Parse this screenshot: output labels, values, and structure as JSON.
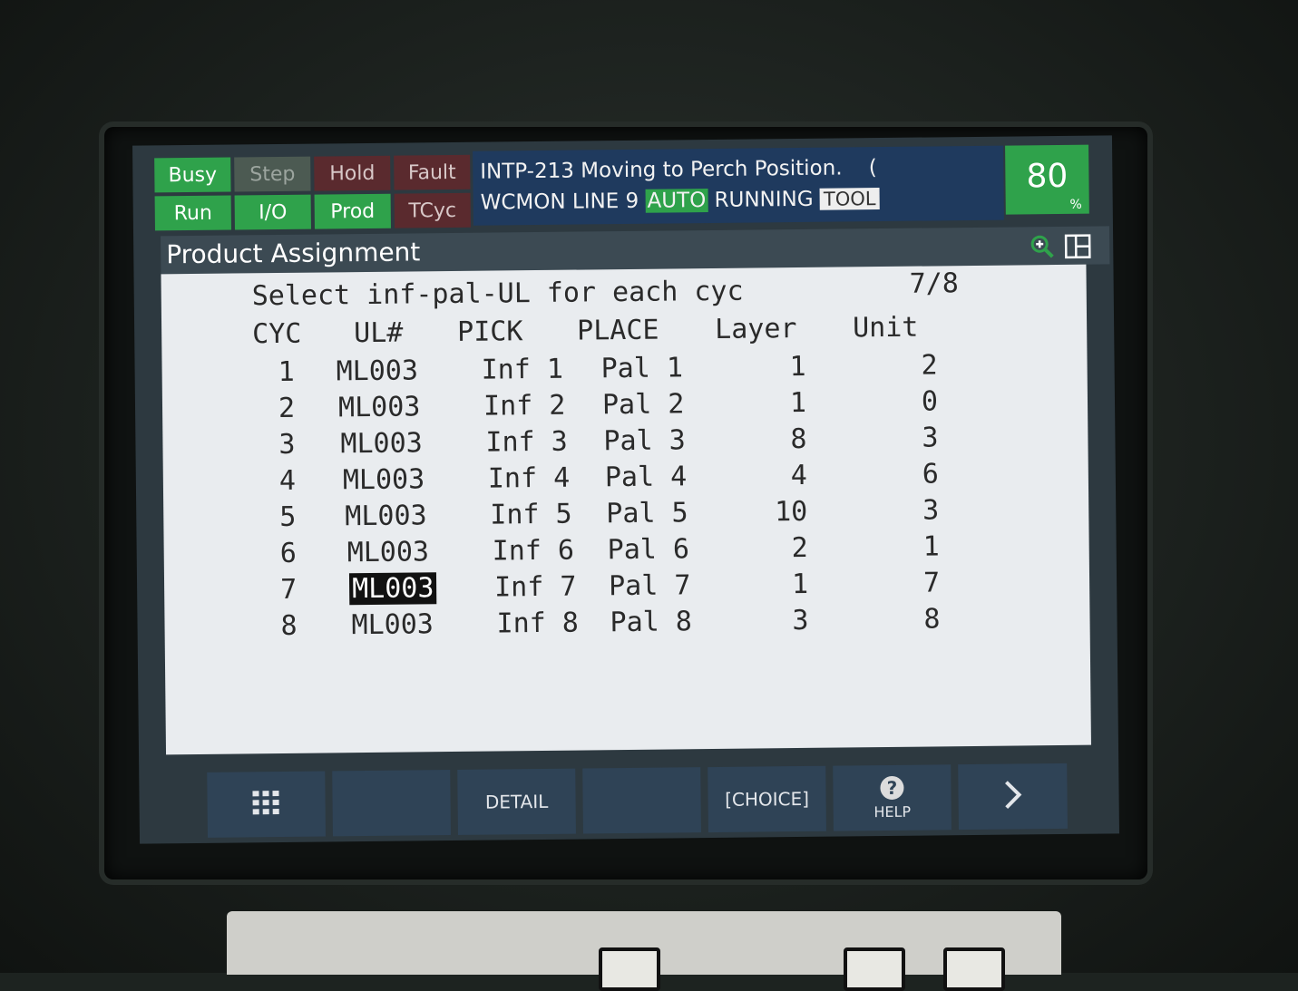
{
  "status_buttons": [
    {
      "label": "Busy",
      "state": "active"
    },
    {
      "label": "Step",
      "state": "inactive"
    },
    {
      "label": "Hold",
      "state": "inactive-red"
    },
    {
      "label": "Fault",
      "state": "inactive-red"
    },
    {
      "label": "Run",
      "state": "active"
    },
    {
      "label": "I/O",
      "state": "active"
    },
    {
      "label": "Prod",
      "state": "active"
    },
    {
      "label": "TCyc",
      "state": "inactive-red"
    }
  ],
  "message": {
    "line1": "INTP-213 Moving to Perch Position.    (",
    "line2_prefix": "WCMON LINE 9",
    "auto": "AUTO",
    "running": "RUNNING",
    "tool": "TOOL"
  },
  "override": {
    "value": "80",
    "unit": "%"
  },
  "title": "Product Assignment",
  "content": {
    "header": "Select inf-pal-UL for each cyc",
    "page": "7/8",
    "columns": [
      "CYC",
      "UL#",
      "PICK",
      "PLACE",
      "Layer",
      "Unit"
    ],
    "rows": [
      {
        "cyc": "1",
        "ul": "ML003",
        "pick": "Inf 1",
        "place": "Pal 1",
        "layer": "1",
        "unit": "2"
      },
      {
        "cyc": "2",
        "ul": "ML003",
        "pick": "Inf 2",
        "place": "Pal 2",
        "layer": "1",
        "unit": "0"
      },
      {
        "cyc": "3",
        "ul": "ML003",
        "pick": "Inf 3",
        "place": "Pal 3",
        "layer": "8",
        "unit": "3"
      },
      {
        "cyc": "4",
        "ul": "ML003",
        "pick": "Inf 4",
        "place": "Pal 4",
        "layer": "4",
        "unit": "6"
      },
      {
        "cyc": "5",
        "ul": "ML003",
        "pick": "Inf 5",
        "place": "Pal 5",
        "layer": "10",
        "unit": "3"
      },
      {
        "cyc": "6",
        "ul": "ML003",
        "pick": "Inf 6",
        "place": "Pal 6",
        "layer": "2",
        "unit": "1"
      },
      {
        "cyc": "7",
        "ul": "ML003",
        "pick": "Inf 7",
        "place": "Pal 7",
        "layer": "1",
        "unit": "7"
      },
      {
        "cyc": "8",
        "ul": "ML003",
        "pick": "Inf 8",
        "place": "Pal 8",
        "layer": "3",
        "unit": "8"
      }
    ],
    "selected_row": 7
  },
  "function_keys": {
    "menu_icon": "grid-icon",
    "f2": "",
    "detail": "DETAIL",
    "f4": "",
    "choice": "[CHOICE]",
    "help": "HELP",
    "next_icon": "chevron-right-icon"
  },
  "icons": {
    "zoom": "zoom-in-icon",
    "split": "split-window-icon"
  },
  "colors": {
    "green": "#2fa24b",
    "blue": "#1f3a5e",
    "content_bg": "#e9ecef"
  }
}
